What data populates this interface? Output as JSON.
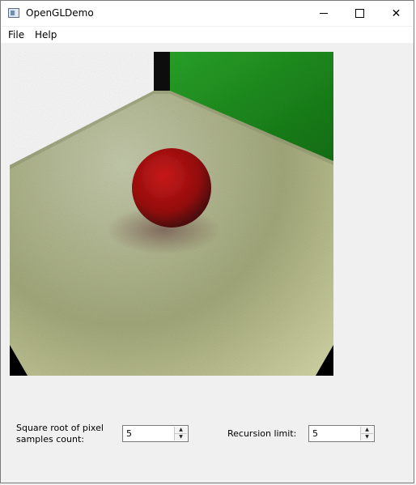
{
  "window": {
    "title": "OpenGLDemo",
    "controls": {
      "minimize_icon": "minimize-icon",
      "maximize_icon": "maximize-icon",
      "close_icon": "close-icon",
      "close_glyph": "✕"
    }
  },
  "menu": {
    "items": [
      {
        "label": "File"
      },
      {
        "label": "Help"
      }
    ]
  },
  "render_view": {
    "colors": {
      "floor": "#aab27e",
      "left_wall": "#ffffff",
      "right_wall": "#1d8f1d",
      "sphere": "#c01010",
      "corner_shadow": "#000000"
    }
  },
  "settings": {
    "samples_label_line1": "Square root of pixel",
    "samples_label_line2": "samples count:",
    "samples_value": "5",
    "recursion_label": "Recursion limit:",
    "recursion_value": "5",
    "up_glyph": "▲",
    "down_glyph": "▼"
  }
}
